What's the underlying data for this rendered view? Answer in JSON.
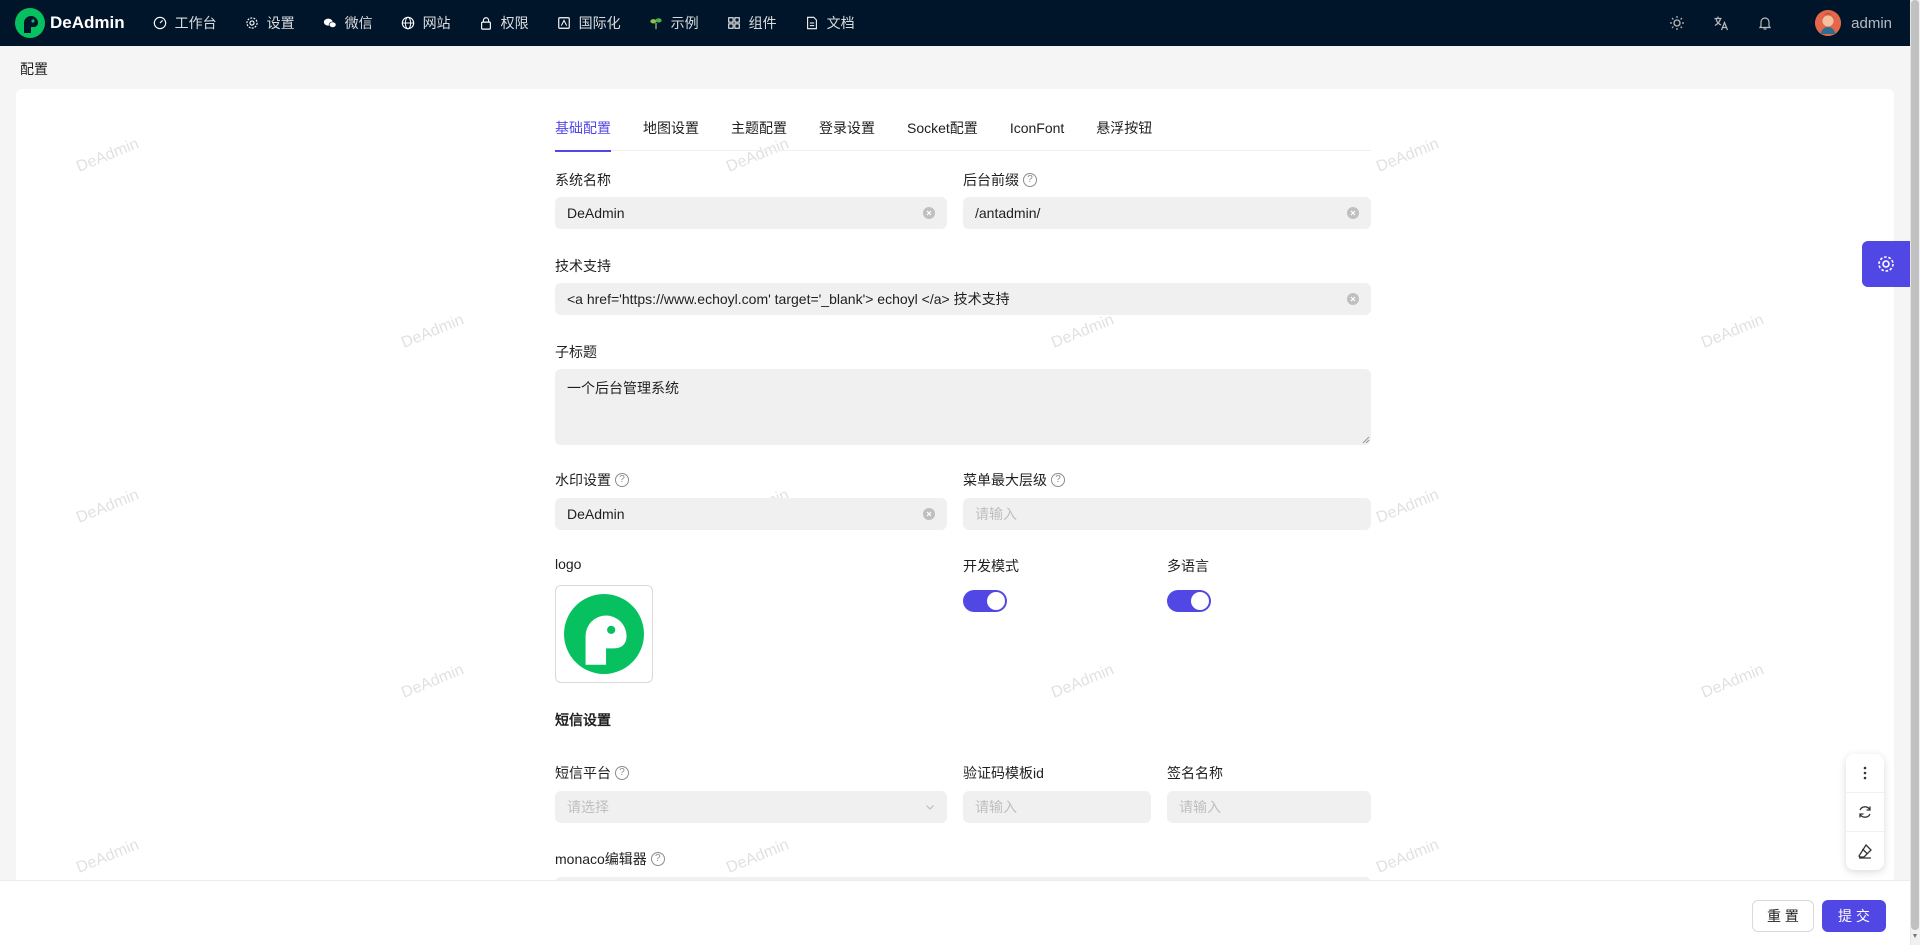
{
  "app": {
    "brand": "DeAdmin"
  },
  "nav": [
    {
      "label": "工作台",
      "icon": "dashboard-icon"
    },
    {
      "label": "设置",
      "icon": "gear-icon"
    },
    {
      "label": "微信",
      "icon": "wechat-icon"
    },
    {
      "label": "网站",
      "icon": "globe-icon"
    },
    {
      "label": "权限",
      "icon": "lock-icon"
    },
    {
      "label": "国际化",
      "icon": "translate-doc-icon"
    },
    {
      "label": "示例",
      "icon": "sprout-icon"
    },
    {
      "label": "组件",
      "icon": "grid-icon"
    },
    {
      "label": "文档",
      "icon": "file-icon"
    }
  ],
  "header_tools": {
    "user_name": "admin"
  },
  "breadcrumb": "配置",
  "watermark_text": "DeAdmin",
  "tabs": [
    "基础配置",
    "地图设置",
    "主题配置",
    "登录设置",
    "Socket配置",
    "IconFont",
    "悬浮按钮"
  ],
  "form": {
    "system_name": {
      "label": "系统名称",
      "value": "DeAdmin"
    },
    "admin_prefix": {
      "label": "后台前缀",
      "value": "/antadmin/"
    },
    "tech_support": {
      "label": "技术支持",
      "value": "<a href='https://www.echoyl.com' target='_blank'> echoyl </a> 技术支持"
    },
    "subtitle": {
      "label": "子标题",
      "value": "一个后台管理系统"
    },
    "watermark": {
      "label": "水印设置",
      "value": "DeAdmin"
    },
    "menu_max_level": {
      "label": "菜单最大层级",
      "placeholder": "请输入"
    },
    "logo": {
      "label": "logo"
    },
    "dev_mode": {
      "label": "开发模式",
      "on": true
    },
    "multi_lang": {
      "label": "多语言",
      "on": true
    },
    "sms_section": "短信设置",
    "sms_platform": {
      "label": "短信平台",
      "placeholder": "请选择"
    },
    "captcha_template": {
      "label": "验证码模板id",
      "placeholder": "请输入"
    },
    "sign_name": {
      "label": "签名名称",
      "placeholder": "请输入"
    },
    "monaco": {
      "label": "monaco编辑器"
    }
  },
  "footer": {
    "reset": "重 置",
    "submit": "提 交"
  },
  "colors": {
    "primary": "#5147e5",
    "nav_bg": "#001529",
    "logo_green": "#07c160"
  }
}
